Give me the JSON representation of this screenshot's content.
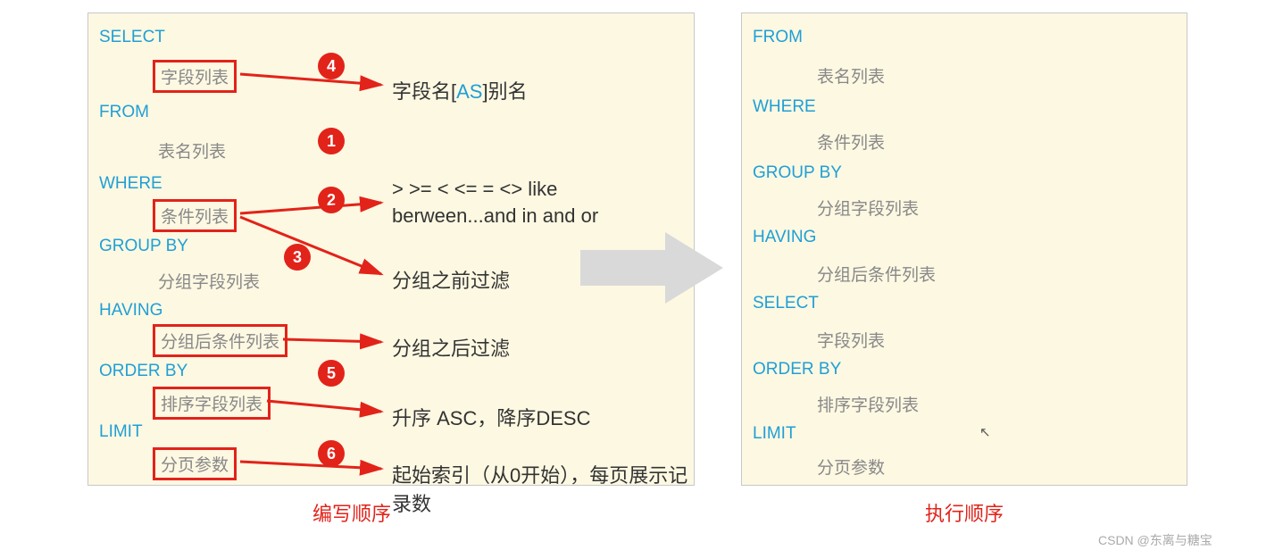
{
  "left": {
    "select": "SELECT",
    "select_sub": "字段列表",
    "from": "FROM",
    "from_sub": "表名列表",
    "where": "WHERE",
    "where_sub": "条件列表",
    "groupby": "GROUP  BY",
    "groupby_sub": "分组字段列表",
    "having": "HAVING",
    "having_sub": "分组后条件列表",
    "orderby": "ORDER BY",
    "orderby_sub": "排序字段列表",
    "limit": "LIMIT",
    "limit_sub": "分页参数"
  },
  "badges": {
    "b1": "1",
    "b2": "2",
    "b3": "3",
    "b4": "4",
    "b5": "5",
    "b6": "6"
  },
  "ann": {
    "select_pre": "字段名[",
    "select_as": "AS",
    "select_post": "]别名",
    "where_l1": "> >= < <= = <> like",
    "where_l2": "berween...and in and or",
    "groupby": "分组之前过滤",
    "having": "分组之后过滤",
    "orderby": "升序 ASC，降序DESC",
    "limit": "起始索引（从0开始），每页展示记录数"
  },
  "right": {
    "from": "FROM",
    "from_sub": "表名列表",
    "where": "WHERE",
    "where_sub": "条件列表",
    "groupby": "GROUP  BY",
    "groupby_sub": "分组字段列表",
    "having": "HAVING",
    "having_sub": "分组后条件列表",
    "select": " SELECT",
    "select_sub": "字段列表",
    "orderby": "ORDER BY",
    "orderby_sub": "排序字段列表",
    "limit": "LIMIT",
    "limit_sub": "分页参数"
  },
  "captions": {
    "left": "编写顺序",
    "right": "执行顺序"
  },
  "watermark": "CSDN @东离与糖宝"
}
